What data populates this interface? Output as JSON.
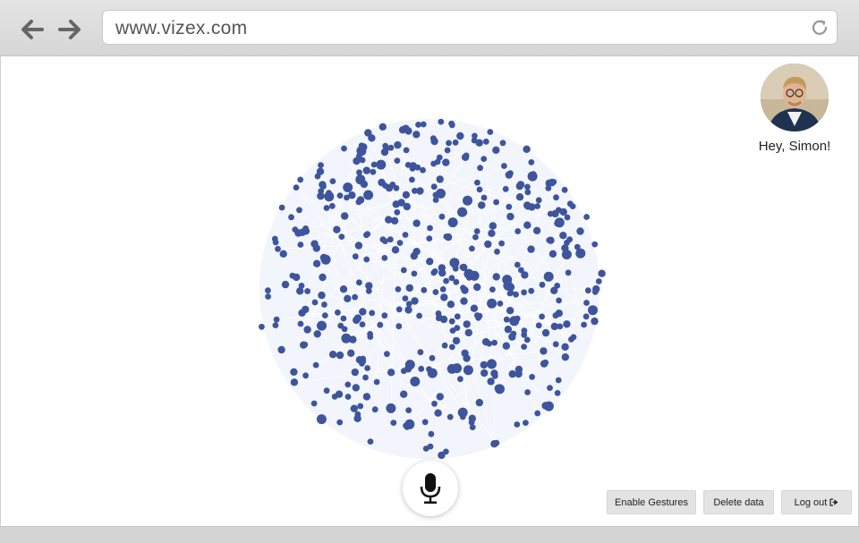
{
  "browser": {
    "url": "www.vizex.com",
    "back_icon": "arrow-left-icon",
    "forward_icon": "arrow-right-icon",
    "reload_icon": "reload-icon"
  },
  "profile": {
    "greeting": "Hey, Simon!"
  },
  "graph": {
    "node_color": "#3e549c",
    "edge_color": "#e8ecf8"
  },
  "controls": {
    "mic_icon": "microphone-icon",
    "enable_gestures_label": "Enable Gestures",
    "delete_data_label": "Delete data",
    "logout_label": "Log out",
    "logout_icon": "sign-out-icon"
  }
}
